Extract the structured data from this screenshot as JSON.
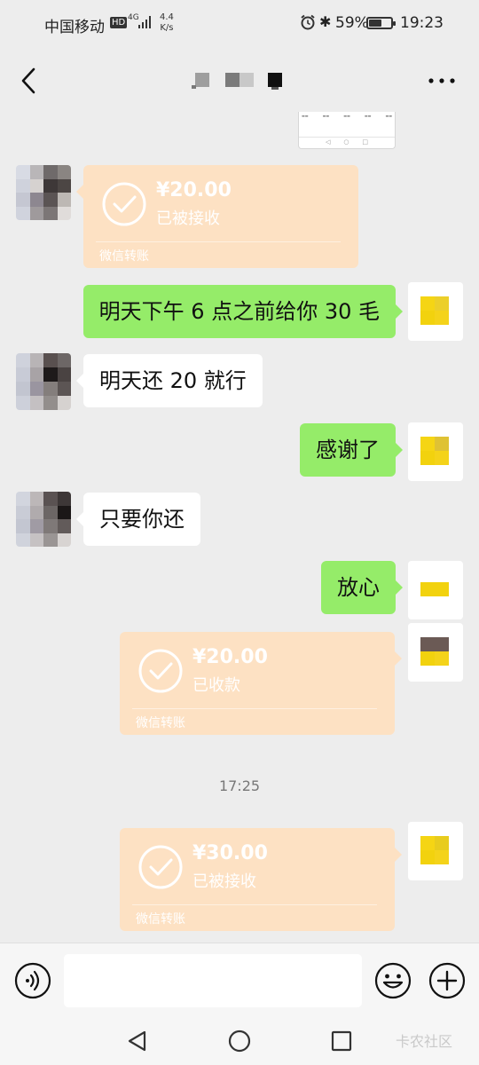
{
  "status_bar": {
    "carrier": "中国移动",
    "hd": "HD",
    "network": "4G",
    "speed_value": "4.4",
    "speed_unit": "K/s",
    "battery_percent": "59%",
    "battery_level": 0.59,
    "time": "19:23"
  },
  "icons": {
    "back": "chevron-left-icon",
    "more": "more-dots-icon",
    "voice": "voice-icon",
    "emoji": "emoji-icon",
    "plus": "plus-icon",
    "check": "check-circle-icon"
  },
  "colors": {
    "background": "#ededed",
    "outgoing_bubble": "#95ec69",
    "incoming_bubble": "#ffffff",
    "transfer_card": "#fde1c3",
    "my_avatar": "#f4d31a"
  },
  "messages": [
    {
      "type": "transfer",
      "from": "other",
      "amount": "¥20.00",
      "status": "已被接收",
      "label": "微信转账"
    },
    {
      "type": "text",
      "from": "me",
      "text": "明天下午 6 点之前给你 30 毛"
    },
    {
      "type": "text",
      "from": "other",
      "text": "明天还 20 就行"
    },
    {
      "type": "text",
      "from": "me",
      "text": "感谢了"
    },
    {
      "type": "text",
      "from": "other",
      "text": "只要你还"
    },
    {
      "type": "text",
      "from": "me",
      "text": "放心"
    },
    {
      "type": "transfer",
      "from": "me",
      "amount": "¥20.00",
      "status": "已收款",
      "label": "微信转账"
    },
    {
      "type": "timestamp",
      "text": "17:25"
    },
    {
      "type": "transfer",
      "from": "me",
      "amount": "¥30.00",
      "status": "已被接收",
      "label": "微信转账"
    }
  ],
  "watermark": "卡农社区"
}
